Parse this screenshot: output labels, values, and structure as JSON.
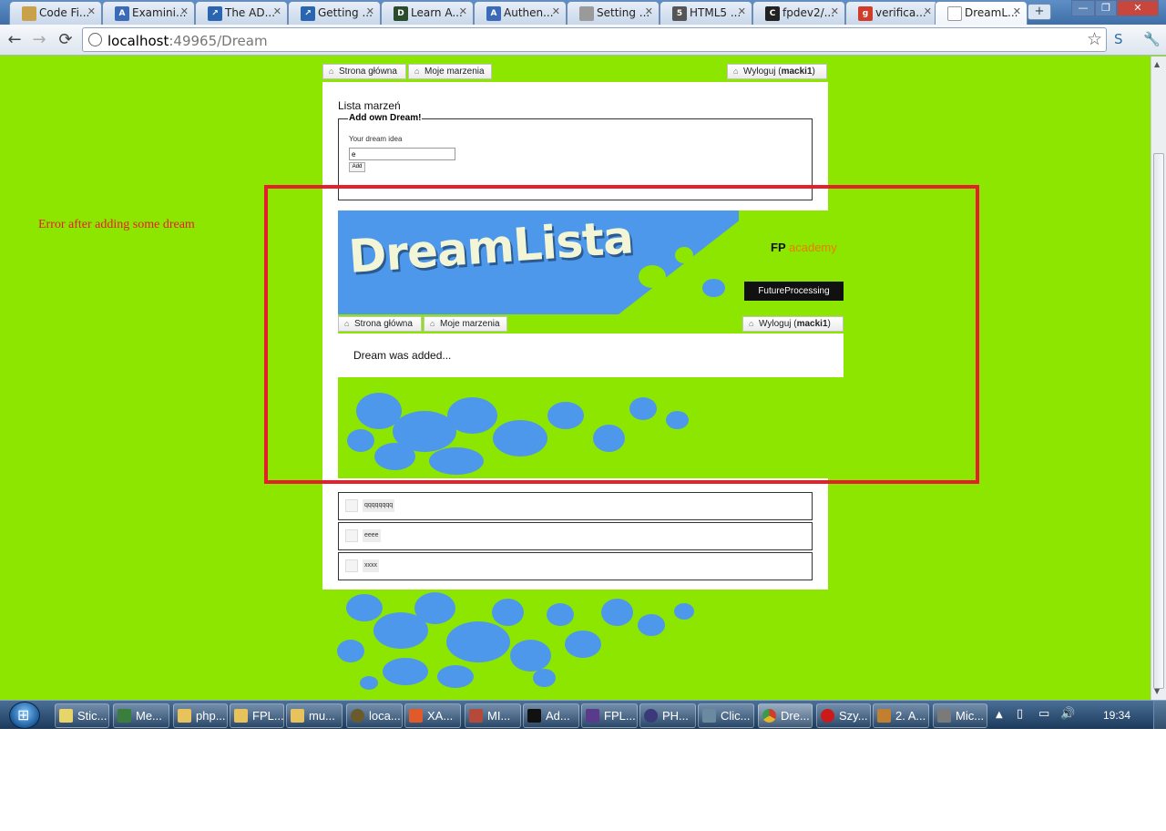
{
  "browser": {
    "tabs": [
      {
        "label": "Code Fi...",
        "icon": "script-icon",
        "color": "#c8a14a"
      },
      {
        "label": "Examini...",
        "icon": "aspnet-icon",
        "color": "#3b6ab8"
      },
      {
        "label": "The AD...",
        "icon": "blue-arrow-icon",
        "color": "#2a66b0"
      },
      {
        "label": "Getting ...",
        "icon": "blue-arrow-icon",
        "color": "#2a66b0"
      },
      {
        "label": "Learn A...",
        "icon": "dev-icon",
        "color": "#2c4a2c"
      },
      {
        "label": "Authen...",
        "icon": "aspnet-icon",
        "color": "#3b6ab8"
      },
      {
        "label": "Setting ...",
        "icon": "page-icon",
        "color": "#9a9a9a"
      },
      {
        "label": "HTML5 ...",
        "icon": "html5-icon",
        "color": "#555555"
      },
      {
        "label": "fpdev2/...",
        "icon": "github-icon",
        "color": "#222222"
      },
      {
        "label": "verifica...",
        "icon": "google-icon",
        "color": "#d13c2a"
      },
      {
        "label": "DreamL...",
        "icon": "page-icon",
        "color": "#ffffff"
      }
    ],
    "url_host": "localhost",
    "url_rest": ":49965/Dream",
    "window_buttons": [
      "—",
      "❐",
      "✕"
    ]
  },
  "page": {
    "nav": {
      "home": "Strona główna",
      "dreams": "Moje marzenia",
      "logout_prefix": "Wyloguj (",
      "username": "macki1",
      "logout_suffix": ")"
    },
    "heading": "Lista marzeń",
    "form": {
      "legend": "Add own Dream!",
      "label": "Your dream idea",
      "input_value": "e",
      "button": "Add"
    },
    "embedded": {
      "logo": "DreamLista",
      "fp_academy_fp": "FP",
      "fp_academy_rest": "academy",
      "future_processing": "FutureProcessing",
      "message": "Dream was added..."
    },
    "dreams": [
      "qqqqqqqq",
      "eeee",
      "xxxx"
    ],
    "annotation": "Error after adding some dream",
    "colors": {
      "background": "#8de600",
      "annotation": "#e4202a",
      "splash": "#4d98ea"
    }
  },
  "taskbar": {
    "items": [
      {
        "label": "Stic...",
        "icon": "sticky-notes-icon",
        "color": "#e8d56a"
      },
      {
        "label": "Me...",
        "icon": "media-icon",
        "color": "#3b7d3b"
      },
      {
        "label": "php...",
        "icon": "folder-icon",
        "color": "#e8c25a"
      },
      {
        "label": "FPL...",
        "icon": "folder-icon",
        "color": "#e8c25a"
      },
      {
        "label": "mu...",
        "icon": "folder-icon",
        "color": "#e8c25a"
      },
      {
        "label": "loca...",
        "icon": "iis-icon",
        "color": "#6b5a2a"
      },
      {
        "label": "XA...",
        "icon": "xampp-icon",
        "color": "#e05a2a"
      },
      {
        "label": "MI...",
        "icon": "mysql-icon",
        "color": "#b54a3a"
      },
      {
        "label": "Ad...",
        "icon": "console-icon",
        "color": "#111111"
      },
      {
        "label": "FPL...",
        "icon": "visual-studio-icon",
        "color": "#5a3a8a"
      },
      {
        "label": "PH...",
        "icon": "eclipse-icon",
        "color": "#3a3a7a"
      },
      {
        "label": "Clic...",
        "icon": "clickonce-icon",
        "color": "#6a8aa0"
      },
      {
        "label": "Dre...",
        "icon": "chrome-icon",
        "color": "#d9b23a"
      },
      {
        "label": "Szy...",
        "icon": "opera-icon",
        "color": "#cc1a1a"
      },
      {
        "label": "2. A...",
        "icon": "pencil-icon",
        "color": "#c08030"
      },
      {
        "label": "Mic...",
        "icon": "tools-icon",
        "color": "#7a7a7a"
      }
    ],
    "clock": "19:34"
  }
}
